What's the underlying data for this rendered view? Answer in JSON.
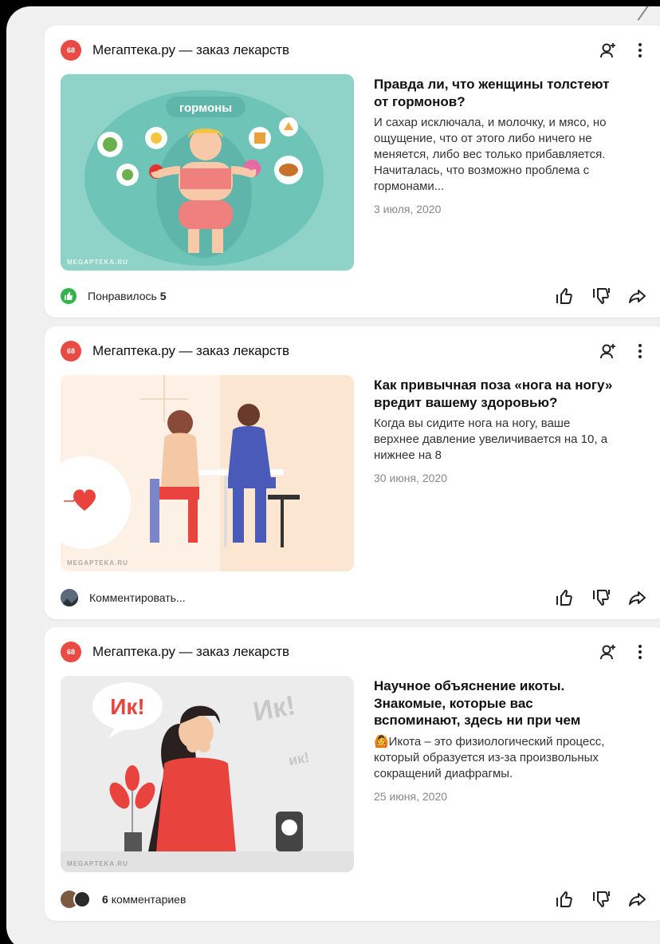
{
  "feed": {
    "cards": [
      {
        "channel_name": "Мегаптека.ру — заказ лекарств",
        "channel_logo_text": "68",
        "title": "Правда ли, что женщины толстеют от гормонов?",
        "snippet": "И сахар исключала, и молочку, и мясо, но ощущение, что от этого либо ничего не меняется, либо вес только прибавляется. Начиталась, что возможно проблема с гормонами...",
        "date": "3 июля, 2020",
        "image_label": "гормоны",
        "watermark": "MEGAPTEKA.RU",
        "footer_text": "Понравилось",
        "footer_count": "5"
      },
      {
        "channel_name": "Мегаптека.ру — заказ лекарств",
        "channel_logo_text": "68",
        "title": "Как привычная поза «нога на ногу» вредит вашему здоровью?",
        "snippet": "Когда вы сидите нога на ногу, ваше верхнее давление увеличивается на 10, а нижнее на 8",
        "date": "30 июня, 2020",
        "watermark": "MEGAPTEKA.RU",
        "footer_text": "Комментировать..."
      },
      {
        "channel_name": "Мегаптека.ру — заказ лекарств",
        "channel_logo_text": "68",
        "title": "Научное объяснение икоты. Знакомые, которые вас вспоминают, здесь ни при чем",
        "snippet": "🙆Икота – это физиологический процесс, который образуется из-за произвольных сокращений диафрагмы.",
        "date": "25 июня, 2020",
        "image_label_big": "Ик!",
        "image_label_mid": "Ик!",
        "image_label_small": "ик!",
        "watermark": "MEGAPTEKA.RU",
        "footer_count": "6",
        "footer_text": "комментариев"
      }
    ]
  },
  "colors": {
    "brand_red": "#e94a43",
    "like_green": "#33b34a",
    "card_bg": "#ffffff",
    "page_bg": "#f0f0f0"
  }
}
